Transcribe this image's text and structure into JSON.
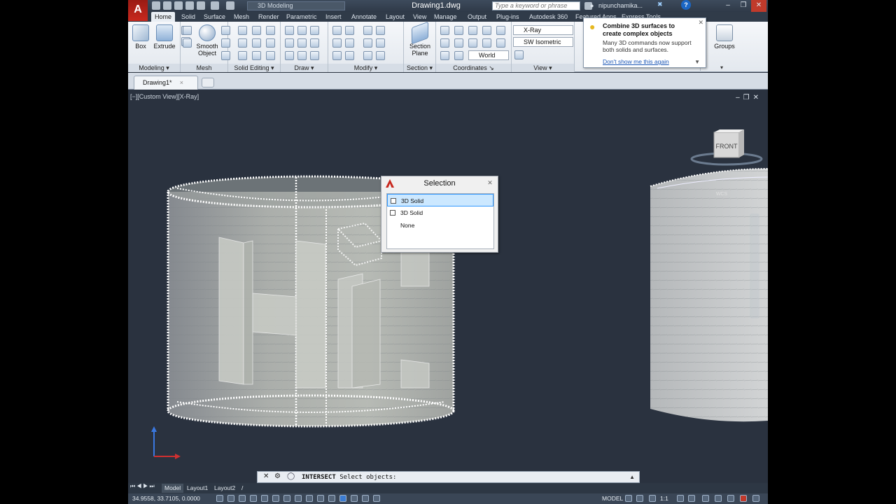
{
  "app": {
    "logo_letter": "A",
    "document_title": "Drawing1.dwg",
    "workspace": "3D Modeling",
    "search_placeholder": "Type a keyword or phrase",
    "user": "nipunchamika..."
  },
  "tabs": [
    "Home",
    "Solid",
    "Surface",
    "Mesh",
    "Render",
    "Parametric",
    "Insert",
    "Annotate",
    "Layout",
    "View",
    "Manage",
    "Output",
    "Plug-ins",
    "Autodesk 360",
    "Featured Apps",
    "Express Tools"
  ],
  "active_tab": "Home",
  "ribbon": {
    "modeling": {
      "label": "Modeling",
      "box": "Box",
      "extrude": "Extrude"
    },
    "mesh": {
      "label": "Mesh",
      "smooth_object": [
        "Smooth",
        "Object"
      ]
    },
    "solid_editing": {
      "label": "Solid Editing"
    },
    "draw": {
      "label": "Draw"
    },
    "modify": {
      "label": "Modify"
    },
    "section": {
      "label": "Section",
      "section_plane": [
        "Section",
        "Plane"
      ]
    },
    "coordinates": {
      "label": "Coordinates",
      "ucs": "World"
    },
    "view": {
      "label": "View",
      "visual_style": "X-Ray",
      "view_direction": "SW Isometric"
    },
    "groups": {
      "label": "Groups"
    }
  },
  "tooltip": {
    "title": "Combine 3D surfaces to create complex objects",
    "body": "Many 3D commands now support both solids and surfaces.",
    "link": "Don't show me this again"
  },
  "file_tab": "Drawing1*",
  "viewport": {
    "label": "[−][Custom View][X-Ray]",
    "viewcube_face": "FRONT",
    "wcs_label": "WCS"
  },
  "selection_dialog": {
    "title": "Selection",
    "items": [
      {
        "label": "3D Solid",
        "selected": true,
        "checkbox": true
      },
      {
        "label": "3D Solid",
        "selected": false,
        "checkbox": true
      },
      {
        "label": "None",
        "selected": false,
        "checkbox": false
      }
    ]
  },
  "command_line": {
    "command": "INTERSECT",
    "prompt": "Select objects:"
  },
  "layout_tabs": [
    "Model",
    "Layout1",
    "Layout2"
  ],
  "status": {
    "coordinates": "34.9558, 33.7105, 0.0000",
    "model": "MODEL",
    "scale": "1:1"
  },
  "colors": {
    "viewport_bg": "#2a323f",
    "ribbon_bg": "#e9eef4",
    "accent_red": "#c8281e"
  }
}
